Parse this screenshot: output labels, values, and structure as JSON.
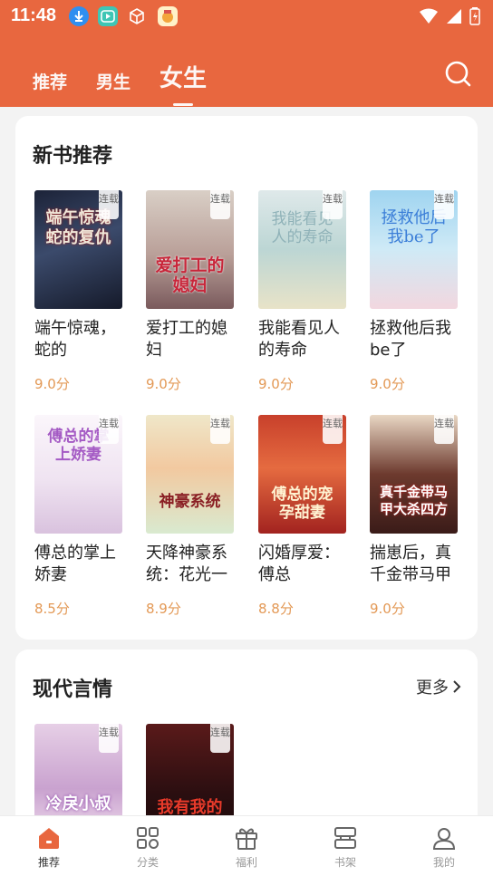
{
  "status_bar": {
    "time": "11:48"
  },
  "tabs": [
    {
      "label": "推荐",
      "active": false
    },
    {
      "label": "男生",
      "active": false
    },
    {
      "label": "女生",
      "active": true
    }
  ],
  "sections": [
    {
      "title": "新书推荐",
      "books": [
        {
          "title": "端午惊魂，蛇的",
          "score": "9.0分",
          "badge": "连载",
          "cover_text": "端午惊魂蛇的复仇"
        },
        {
          "title": "爱打工的媳妇",
          "score": "9.0分",
          "badge": "连载",
          "cover_text": "爱打工的媳妇"
        },
        {
          "title": "我能看见人的寿命",
          "score": "9.0分",
          "badge": "连载",
          "cover_text": "我能看见人的寿命"
        },
        {
          "title": "拯救他后我be了",
          "score": "9.0分",
          "badge": "连载",
          "cover_text": "拯救他后我be了"
        },
        {
          "title": "傅总的掌上娇妻",
          "score": "8.5分",
          "badge": "连载",
          "cover_text": "傅总的掌上娇妻"
        },
        {
          "title": "天降神豪系统：花光一",
          "score": "8.9分",
          "badge": "连载",
          "cover_text": "神豪系统"
        },
        {
          "title": "闪婚厚爱：傅总",
          "score": "8.8分",
          "badge": "连载",
          "cover_text": "傅总的宠孕甜妻"
        },
        {
          "title": "揣崽后，真千金带马甲",
          "score": "9.0分",
          "badge": "连载",
          "cover_text": "真千金带马甲大杀四方"
        }
      ]
    },
    {
      "title": "现代言情",
      "more": "更多",
      "books": [
        {
          "badge": "连载",
          "cover_text": "冷戾小叔"
        },
        {
          "badge": "连载",
          "cover_text": "我有我的"
        }
      ]
    }
  ],
  "bottom_nav": [
    {
      "label": "推荐",
      "icon": "home-icon",
      "active": true
    },
    {
      "label": "分类",
      "icon": "grid-icon",
      "active": false
    },
    {
      "label": "福利",
      "icon": "gift-icon",
      "active": false
    },
    {
      "label": "书架",
      "icon": "bookshelf-icon",
      "active": false
    },
    {
      "label": "我的",
      "icon": "profile-icon",
      "active": false
    }
  ],
  "colors": {
    "brand": "#e8673f",
    "score": "#e39956"
  }
}
